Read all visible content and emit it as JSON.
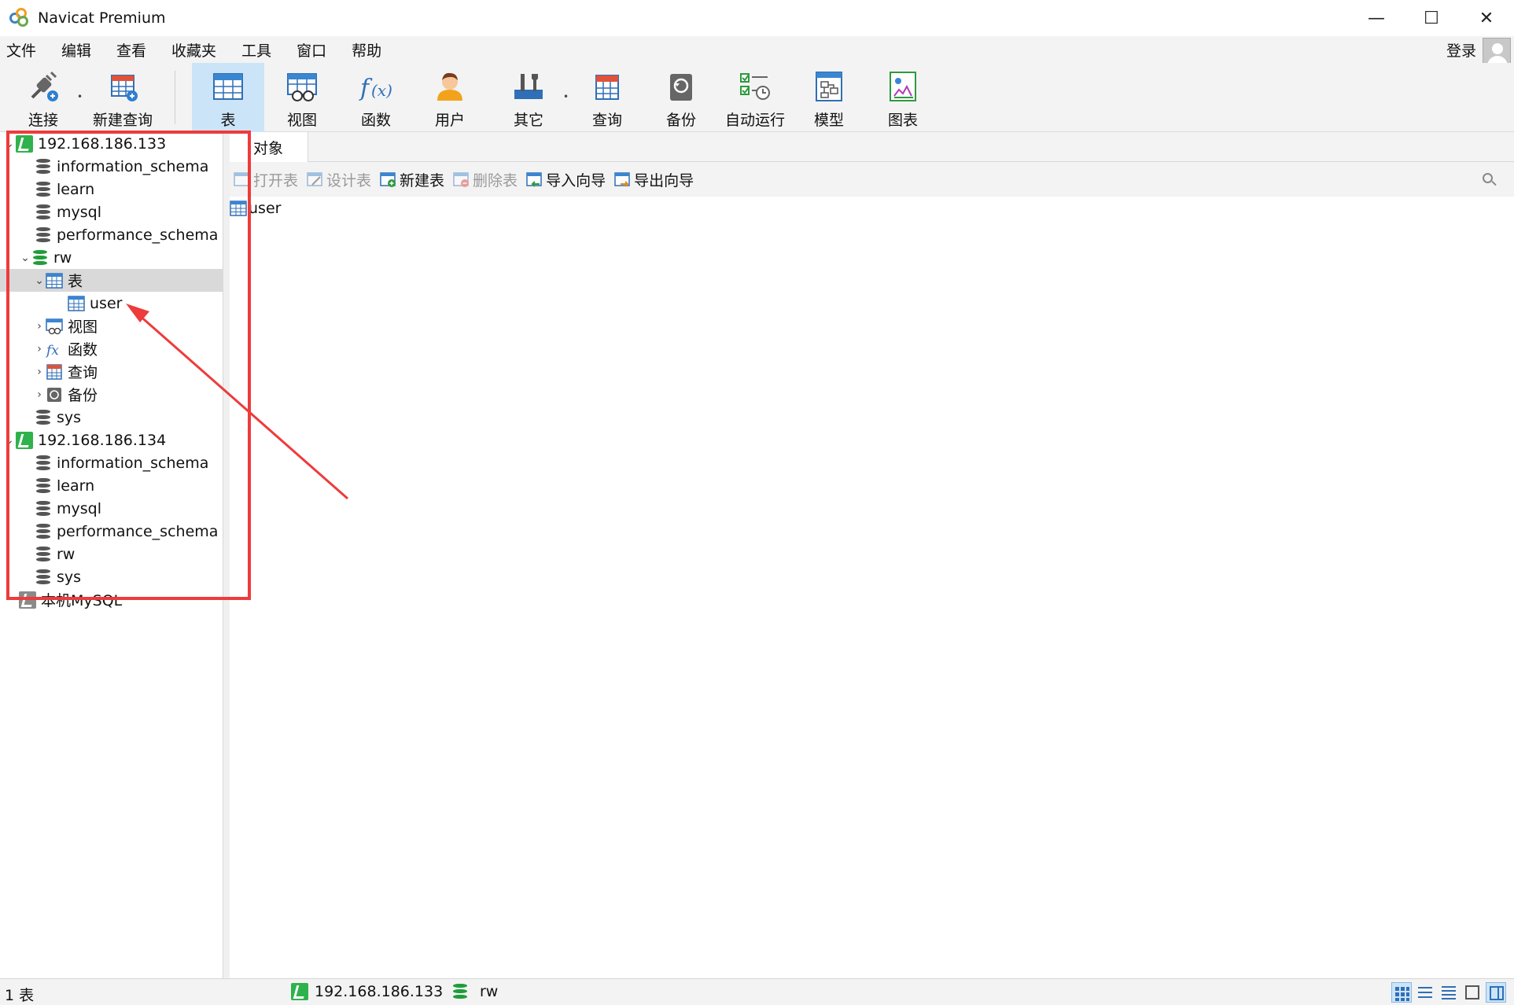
{
  "window": {
    "title": "Navicat Premium",
    "controls": {
      "minimize": "—",
      "maximize": "☐",
      "close": "✕"
    }
  },
  "menu": {
    "items": [
      "文件",
      "编辑",
      "查看",
      "收藏夹",
      "工具",
      "窗口",
      "帮助"
    ],
    "login": "登录"
  },
  "toolbar": {
    "buttons": [
      {
        "label": "连接",
        "icon": "plug-icon"
      },
      {
        "label": "新建查询",
        "icon": "new-query-icon"
      },
      {
        "label": "表",
        "icon": "table-icon",
        "active": true
      },
      {
        "label": "视图",
        "icon": "view-icon"
      },
      {
        "label": "函数",
        "icon": "function-icon"
      },
      {
        "label": "用户",
        "icon": "user-icon"
      },
      {
        "label": "其它",
        "icon": "tools-icon"
      },
      {
        "label": "查询",
        "icon": "query-icon"
      },
      {
        "label": "备份",
        "icon": "backup-icon"
      },
      {
        "label": "自动运行",
        "icon": "schedule-icon"
      },
      {
        "label": "模型",
        "icon": "model-icon"
      },
      {
        "label": "图表",
        "icon": "chart-icon"
      }
    ]
  },
  "tree": {
    "items": [
      {
        "label": "192.168.186.133",
        "type": "connection",
        "chevron": "⌄",
        "level": 0
      },
      {
        "label": "information_schema",
        "type": "database",
        "level": 1
      },
      {
        "label": "learn",
        "type": "database",
        "level": 1
      },
      {
        "label": "mysql",
        "type": "database",
        "level": 1
      },
      {
        "label": "performance_schema",
        "type": "database",
        "level": 1
      },
      {
        "label": "rw",
        "type": "database-open",
        "chevron": "⌄",
        "level": 1
      },
      {
        "label": "表",
        "type": "tables",
        "chevron": "⌄",
        "level": 2,
        "selected": true
      },
      {
        "label": "user",
        "type": "table",
        "level": 3
      },
      {
        "label": "视图",
        "type": "views",
        "chevron": "›",
        "level": 2
      },
      {
        "label": "函数",
        "type": "functions",
        "chevron": "›",
        "level": 2
      },
      {
        "label": "查询",
        "type": "queries",
        "chevron": "›",
        "level": 2
      },
      {
        "label": "备份",
        "type": "backups",
        "chevron": "›",
        "level": 2
      },
      {
        "label": "sys",
        "type": "database",
        "level": 1
      },
      {
        "label": "192.168.186.134",
        "type": "connection",
        "chevron": "⌄",
        "level": 0
      },
      {
        "label": "information_schema",
        "type": "database",
        "level": 1
      },
      {
        "label": "learn",
        "type": "database",
        "level": 1
      },
      {
        "label": "mysql",
        "type": "database",
        "level": 1
      },
      {
        "label": "performance_schema",
        "type": "database",
        "level": 1
      },
      {
        "label": "rw",
        "type": "database",
        "level": 1
      },
      {
        "label": "sys",
        "type": "database",
        "level": 1
      },
      {
        "label": "本机MySQL",
        "type": "connection-closed",
        "level": 0
      }
    ]
  },
  "content": {
    "tab": "对象",
    "actions": [
      {
        "label": "打开表",
        "enabled": false
      },
      {
        "label": "设计表",
        "enabled": false
      },
      {
        "label": "新建表",
        "enabled": true
      },
      {
        "label": "删除表",
        "enabled": false
      },
      {
        "label": "导入向导",
        "enabled": true
      },
      {
        "label": "导出向导",
        "enabled": true
      }
    ],
    "objects": [
      "user"
    ]
  },
  "status": {
    "count": "1 表",
    "connection": "192.168.186.133",
    "database": "rw"
  },
  "colors": {
    "accent": "#cce4f7",
    "annotation": "#ee3b3b",
    "connection_green": "#2fb24c",
    "db_green": "#1f9d3a"
  }
}
